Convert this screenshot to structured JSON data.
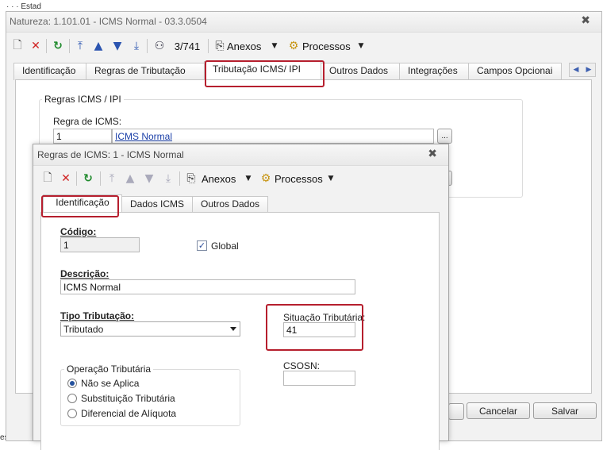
{
  "background": {
    "top_fragment": "·  · · Estad",
    "bottom_fragment": "es de Se"
  },
  "outer": {
    "title": "Natureza: 1.101.01 - ICMS Normal - 03.3.0504",
    "toolbar": {
      "counter": "3/741",
      "anexos": "Anexos",
      "processos": "Processos"
    },
    "tabs": [
      "Identificação",
      "Regras de Tributação",
      "Tributação ICMS/ IPI",
      "Outros Dados",
      "Integrações",
      "Campos Opcionai"
    ],
    "group_title": "Regras ICMS / IPI",
    "regra_label": "Regra de ICMS:",
    "regra_code": "1",
    "regra_link": "ICMS Normal",
    "browse": "...",
    "buttons": {
      "cancelar": "Cancelar",
      "salvar": "Salvar"
    }
  },
  "inner": {
    "title": "Regras de ICMS: 1 - ICMS Normal",
    "toolbar": {
      "anexos": "Anexos",
      "processos": "Processos"
    },
    "tabs": [
      "Identificação",
      "Dados ICMS",
      "Outros Dados"
    ],
    "codigo_label": "Código:",
    "codigo_value": "1",
    "global_label": "Global",
    "descricao_label": "Descrição:",
    "descricao_value": "ICMS Normal",
    "tipo_label": "Tipo Tributação:",
    "tipo_value": "Tributado",
    "situacao_label": "Situação Tributária:",
    "situacao_value": "41",
    "csosn_label": "CSOSN:",
    "csosn_value": "",
    "operacao": {
      "title": "Operação Tributária",
      "options": [
        "Não se Aplica",
        "Substituição Tributária",
        "Diferencial de Alíquota"
      ],
      "selected": 0
    }
  },
  "colors": {
    "highlight": "#b61f2e",
    "link": "#1a3fa8",
    "accent": "#24519d"
  }
}
